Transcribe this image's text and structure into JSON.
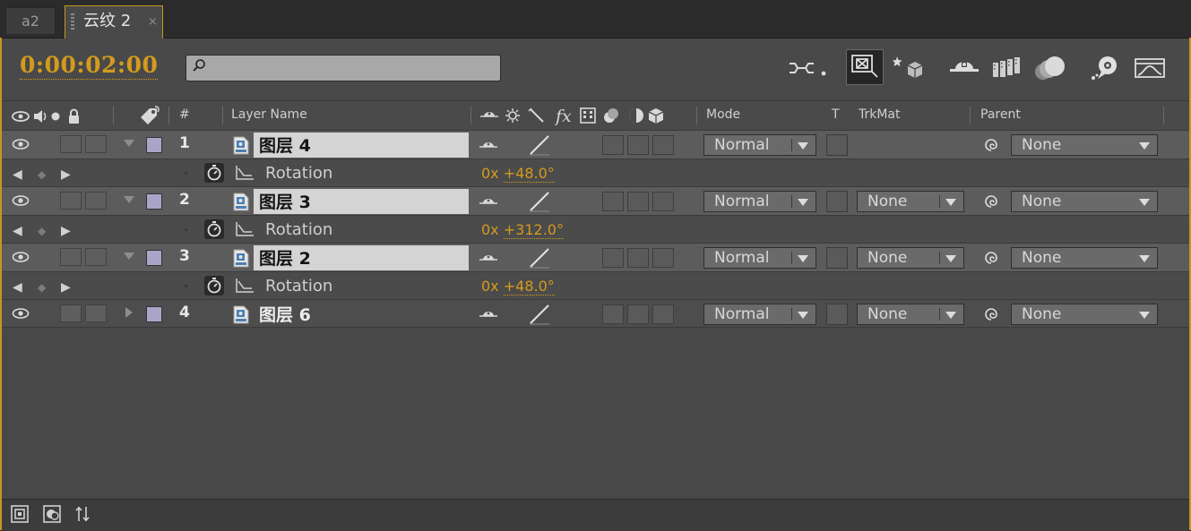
{
  "tabs": [
    {
      "label": "a2",
      "active": false
    },
    {
      "label": "云纹 2",
      "active": true,
      "close_glyph": "×"
    }
  ],
  "header": {
    "timecode": "0:00:02:00",
    "search": {
      "value": "",
      "placeholder": ""
    }
  },
  "toolbar_icons": [
    "composition-flowchart-icon",
    "draft-3d-icon",
    "3d-layer-icon",
    "shy-layers-icon",
    "frame-blending-icon",
    "motion-blur-icon",
    "brainstorm-icon",
    "graph-editor-icon"
  ],
  "columns": {
    "layer_name": "Layer Name",
    "number": "#",
    "mode": "Mode",
    "t": "T",
    "trkmat": "TrkMat",
    "parent": "Parent",
    "fx": "fx"
  },
  "layers": [
    {
      "number": "1",
      "name": "图层 4",
      "selected": true,
      "expanded": true,
      "mode": "Normal",
      "trkmat": "",
      "parent": "None",
      "property": {
        "label": "Rotation",
        "revolutions": "0x",
        "value": "+48.0°"
      }
    },
    {
      "number": "2",
      "name": "图层 3",
      "selected": true,
      "expanded": true,
      "mode": "Normal",
      "trkmat": "None",
      "parent": "None",
      "property": {
        "label": "Rotation",
        "revolutions": "0x",
        "value": "+312.0°"
      }
    },
    {
      "number": "3",
      "name": "图层 2",
      "selected": true,
      "expanded": true,
      "mode": "Normal",
      "trkmat": "None",
      "parent": "None",
      "property": {
        "label": "Rotation",
        "revolutions": "0x",
        "value": "+48.0°"
      }
    },
    {
      "number": "4",
      "name": "图层 6",
      "selected": false,
      "expanded": false,
      "mode": "Normal",
      "trkmat": "None",
      "parent": "None"
    }
  ],
  "bottom_icons": [
    "layer-switches-icon",
    "transfer-controls-icon",
    "in-out-toggle-icon"
  ],
  "colors": {
    "accent": "#d49b1c",
    "frame": "#c8961f",
    "label": "#a9a5c9"
  }
}
